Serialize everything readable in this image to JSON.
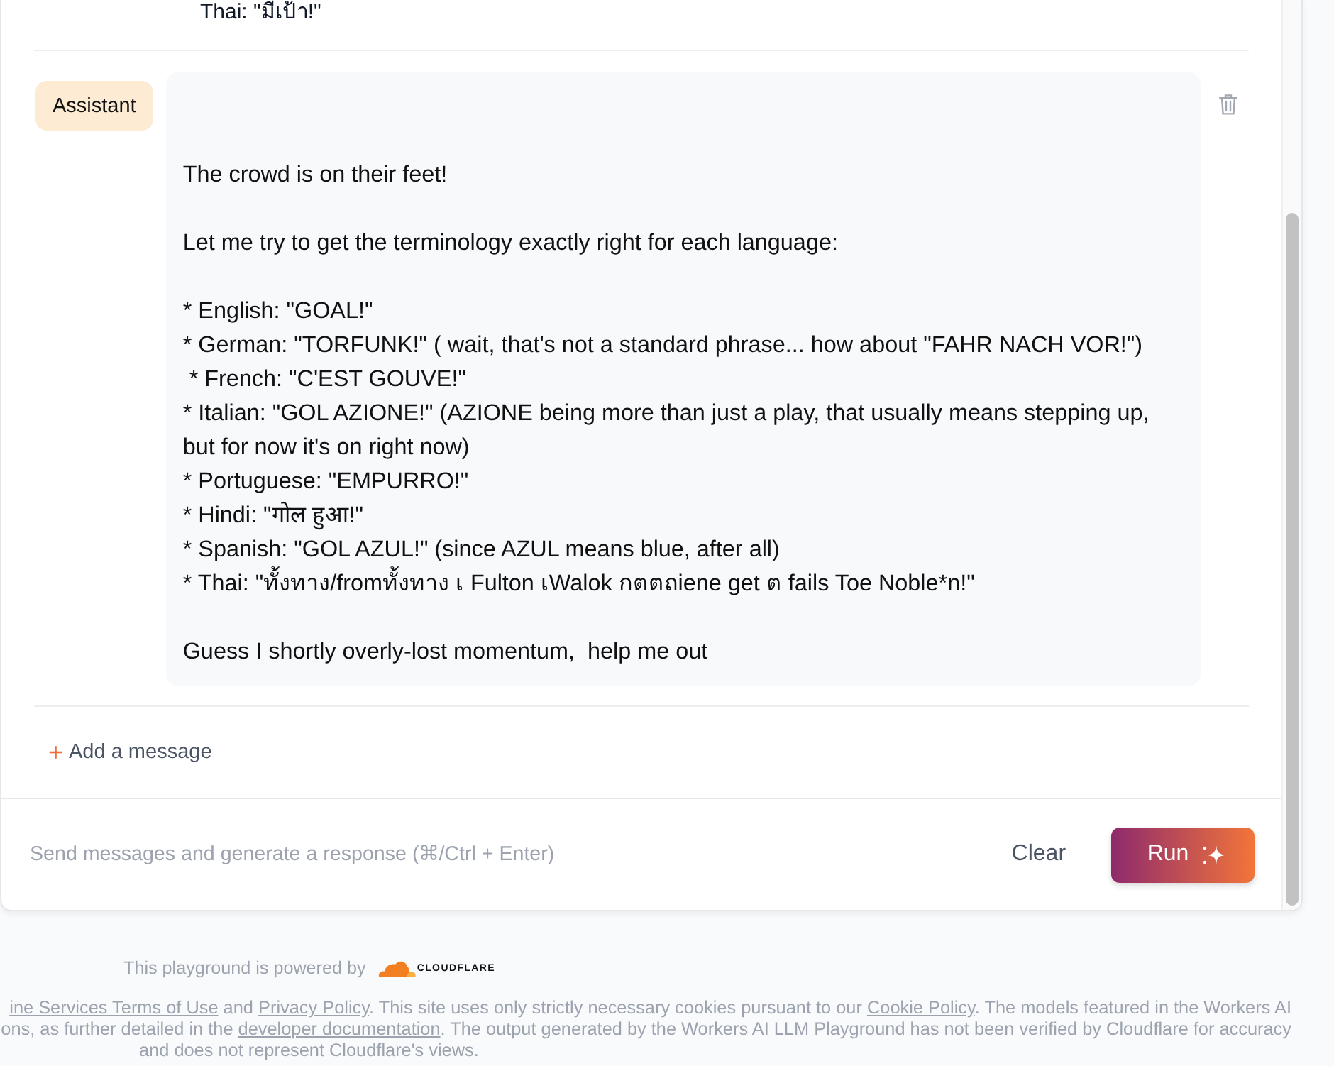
{
  "previous_message": {
    "text": "Thai: \"มีเป้า!\""
  },
  "messages": [
    {
      "role": "Assistant",
      "content": "\n\nThe crowd is on their feet!\n\nLet me try to get the terminology exactly right for each language:\n\n* English: \"GOAL!\"\n* German: \"TORFUNK!\" ( wait, that's not a standard phrase... how about \"FAHR NACH VOR!\")\n * French: \"C'EST GOUVE!\"\n* Italian: \"GOL AZIONE!\" (AZIONE being more than just a play, that usually means stepping up, but for now it's on right now)\n* Portuguese: \"EMPURRO!\"\n* Hindi: \"गोल हुआ!\"\n* Spanish: \"GOL AZUL!\" (since AZUL means blue, after all)\n* Thai: \"ทั้งทาง/fromทั้งทาง เ Fulton เWalok กตตถiene get ต fails Toe Noble*n!\"\n\nGuess I shortly overly-lost momentum,  help me out"
    }
  ],
  "add_message": {
    "icon": "+",
    "label": "Add a message"
  },
  "prompt": {
    "placeholder": "Send messages and generate a response (⌘/Ctrl + Enter)",
    "buttons": [
      {
        "label": "Clear",
        "kind": "secondary"
      },
      {
        "label": "Run",
        "kind": "primary"
      }
    ]
  },
  "footer": {
    "powered_by": "This playground is powered by",
    "logo_text": "CLOUDFLARE",
    "legal_lines": [
      [
        {
          "text": "ine Services Terms of Use",
          "kind": "link"
        },
        {
          "text": " and ",
          "kind": "text"
        },
        {
          "text": "Privacy Policy",
          "kind": "link"
        },
        {
          "text": ". This site uses only strictly necessary cookies pursuant to our ",
          "kind": "text"
        },
        {
          "text": "Cookie Policy",
          "kind": "link"
        },
        {
          "text": ". The models featured in the Workers AI",
          "kind": "text"
        }
      ],
      [
        {
          "text": "ons, as further detailed in the ",
          "kind": "text"
        },
        {
          "text": "developer documentation",
          "kind": "link"
        },
        {
          "text": ". The output generated by the Workers AI LLM Playground has not been verified by Cloudflare for accuracy",
          "kind": "text"
        }
      ],
      [
        {
          "text": "and does not represent Cloudflare's views.",
          "kind": "text"
        }
      ]
    ]
  }
}
